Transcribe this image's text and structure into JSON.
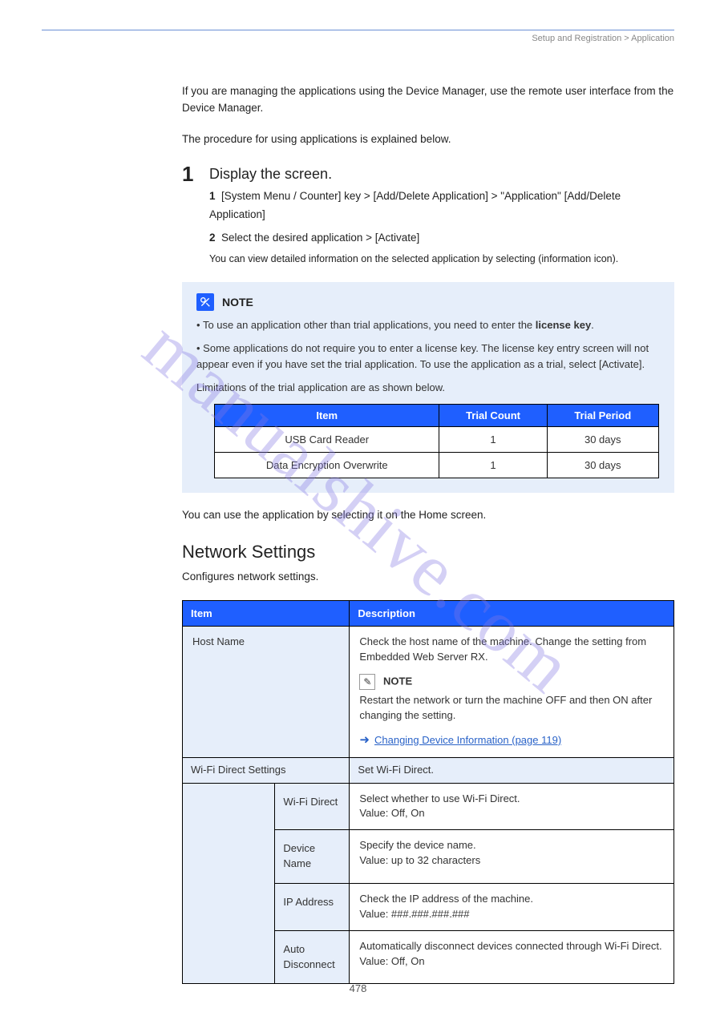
{
  "header": "Setup and Registration > Application",
  "watermark": "manualshive.com",
  "intro": "If you are managing the applications using the Device Manager, use the remote user interface from the Device Manager.",
  "intro_para2": "The procedure for using applications is explained below.",
  "step": {
    "number": "1",
    "title": "Display the screen.",
    "line1": "1",
    "line1_text": "[System Menu / Counter] key > [Add/Delete Application] > \"Application\" [Add/Delete Application]",
    "line2": "2",
    "line2_text": "Select the desired application > [Activate]",
    "detail_note": "    You can view detailed information on the selected application by selecting  (information icon)."
  },
  "note": {
    "label": "NOTE",
    "bullet1_prefix": "• ",
    "bullet1": "To use an application other than trial applications, you need to enter the ",
    "bullet1_bold": "license key",
    "bullet1_suffix": ".",
    "bullet2_prefix": "• ",
    "bullet2": "Some applications do not require you to enter a license key. The license key entry screen will not appear even if you have set the trial application. To use the application as a trial, select [Activate].",
    "limits_intro": "Limitations of the trial application are as shown below.",
    "table": {
      "headers": [
        "Item",
        "Trial Count",
        "Trial Period"
      ],
      "rows": [
        [
          "USB Card Reader",
          "1",
          "30 days"
        ],
        [
          "Data Encryption Overwrite",
          "1",
          "30 days"
        ]
      ]
    }
  },
  "post_note": "You can use the application by selecting it on the Home screen.",
  "nw_section": {
    "title": "Network Settings",
    "intro": "Configures network settings."
  },
  "settings_table": {
    "hdr_item": "Item",
    "hdr_desc": "Description",
    "host": {
      "item": "Host Name",
      "desc": "Check the host name of the machine. Change the setting from Embedded Web Server RX.",
      "note_label": "NOTE",
      "note_text": "Restart the network or turn the machine OFF and then ON after changing the setting.",
      "ref_prefix": "➜",
      "ref": "Changing Device Information (page 119)"
    },
    "wifi": {
      "item": "Wi-Fi Direct Settings",
      "desc": "Set Wi-Fi Direct.",
      "row1_item": "Wi-Fi Direct",
      "row1_desc": "Select whether to use Wi-Fi Direct.\nValue: Off, On",
      "row2_item": "Device Name",
      "row2_desc": "Specify the device name.\nValue: up to 32 characters",
      "row3_item": "IP Address",
      "row3_desc": "Check the IP address of the machine.\nValue: ###.###.###.###",
      "row4_item": "Auto Disconnect",
      "row4_desc": "Automatically disconnect devices connected through Wi-Fi Direct.\nValue: Off, On"
    }
  },
  "page_number": "478"
}
